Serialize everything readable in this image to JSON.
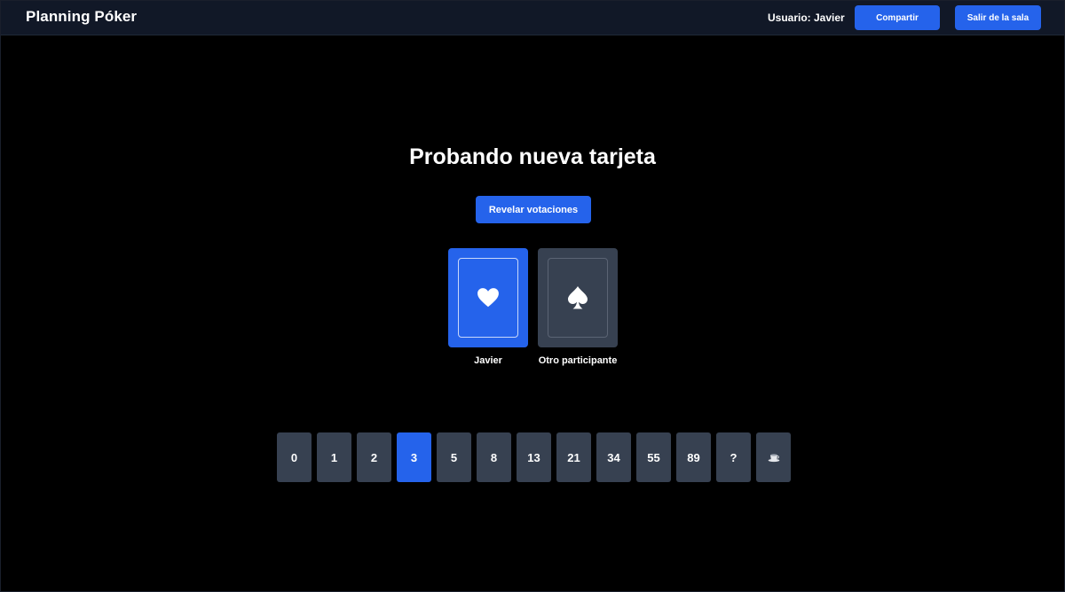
{
  "header": {
    "app_title": "Planning Póker",
    "user_label": "Usuario: Javier",
    "share_button": "Compartir",
    "leave_button": "Salir de la sala"
  },
  "room": {
    "title": "Probando nueva tarjeta",
    "reveal_button": "Revelar votaciones"
  },
  "players": [
    {
      "name": "Javier",
      "status": "voted",
      "card_icon": "heart-icon"
    },
    {
      "name": "Otro participante",
      "status": "waiting",
      "card_icon": "spade-icon"
    }
  ],
  "deck": {
    "cards": [
      "0",
      "1",
      "2",
      "3",
      "5",
      "8",
      "13",
      "21",
      "34",
      "55",
      "89",
      "?",
      "coffee-cup-icon"
    ],
    "selected": "3"
  },
  "colors": {
    "accent": "#2563eb",
    "header_bg": "#111827",
    "card_bg": "#374151",
    "page_bg": "#000000"
  }
}
